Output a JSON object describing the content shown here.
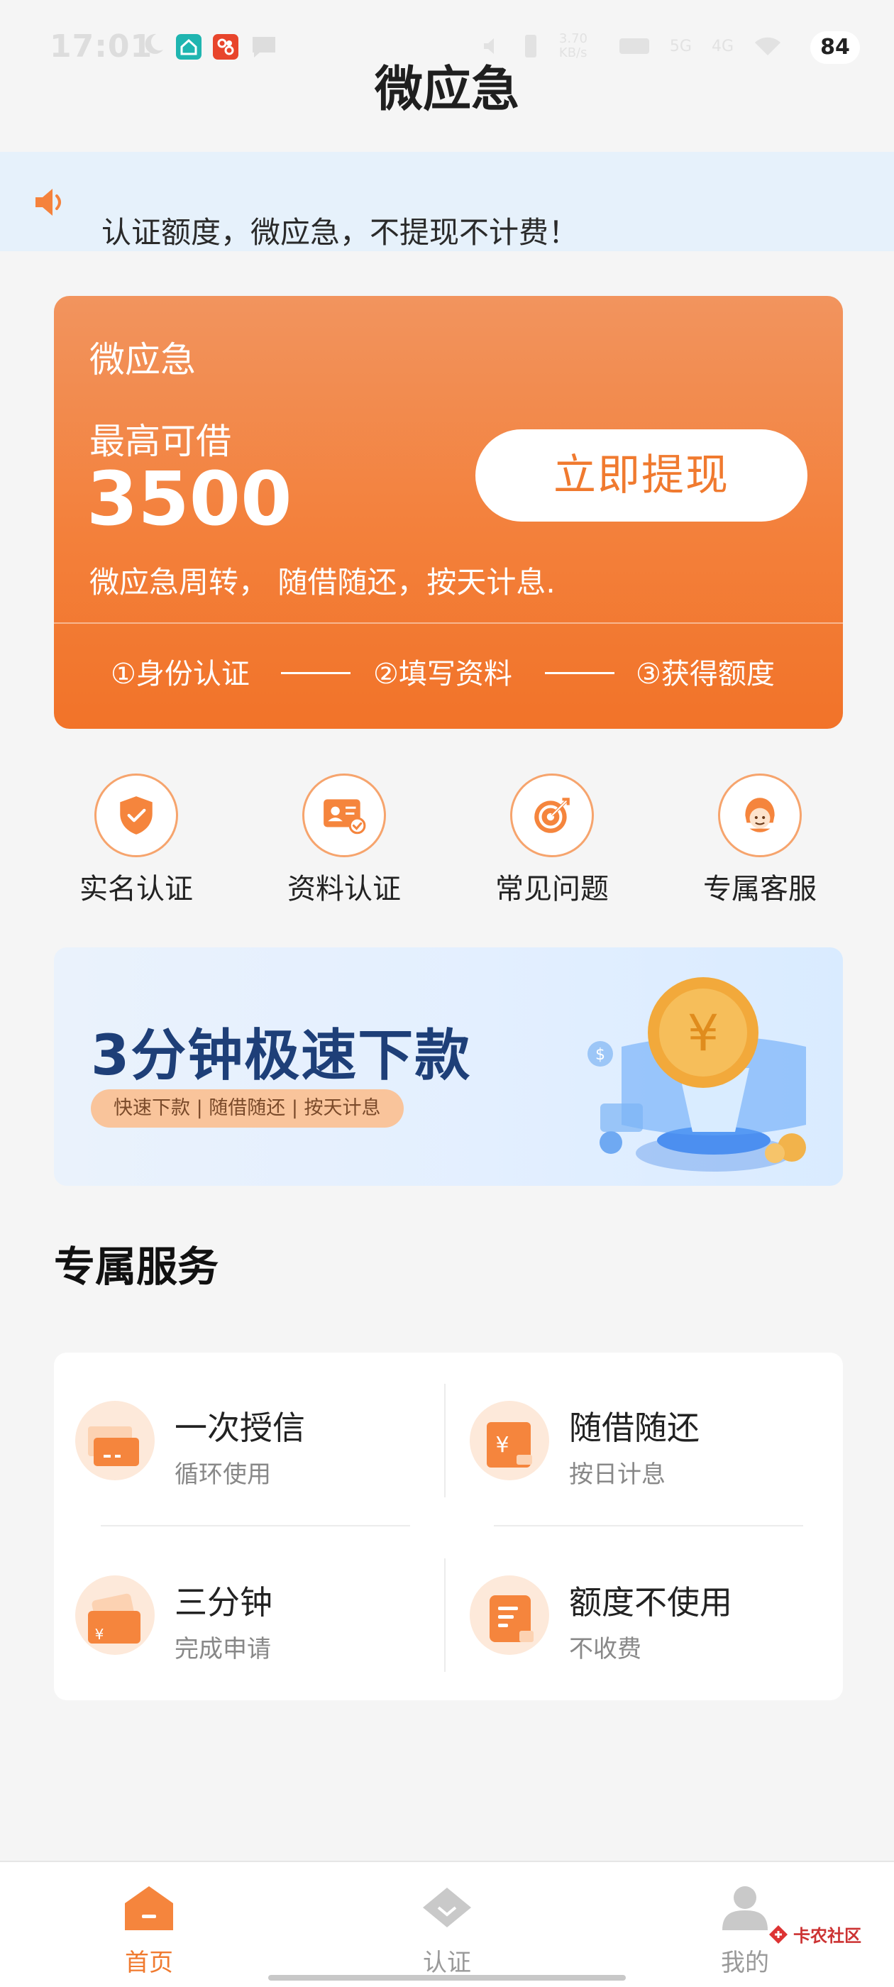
{
  "status_bar": {
    "time": "17:01",
    "net_speed": "3.70 KB/s",
    "signal_1": "5G",
    "signal_2": "4G",
    "battery": "84",
    "icons": [
      "moon-icon",
      "home-app-icon",
      "app-icon",
      "message-icon",
      "mute-icon",
      "vibrate-icon",
      "hd-icon",
      "wifi-icon"
    ]
  },
  "header": {
    "title": "微应急"
  },
  "notice": {
    "text": "认证额度，微应急，不提现不计费！",
    "icon": "speaker-icon"
  },
  "hero": {
    "brand": "微应急",
    "label": "最高可借",
    "amount": "3500",
    "button": "立即提现",
    "desc": "微应急周转， 随借随还，按天计息.",
    "steps": [
      "①身份认证",
      "②填写资料",
      "③获得额度"
    ]
  },
  "quick_actions": [
    {
      "label": "实名认证",
      "icon": "shield-check-icon"
    },
    {
      "label": "资料认证",
      "icon": "id-card-icon"
    },
    {
      "label": "常见问题",
      "icon": "target-icon"
    },
    {
      "label": "专属客服",
      "icon": "customer-service-icon"
    }
  ],
  "banner": {
    "title": "3分钟极速下款",
    "pill": "快速下款 | 随借随还 | 按天计息"
  },
  "services": {
    "title": "专属服务",
    "items": [
      {
        "title": "一次授信",
        "sub": "循环使用",
        "icon": "card-icon"
      },
      {
        "title": "随借随还",
        "sub": "按日计息",
        "icon": "yuan-note-icon"
      },
      {
        "title": "三分钟",
        "sub": "完成申请",
        "icon": "wallet-icon"
      },
      {
        "title": "额度不使用",
        "sub": "不收费",
        "icon": "document-icon"
      }
    ]
  },
  "tabbar": {
    "items": [
      {
        "label": "首页",
        "icon": "home-icon",
        "active": true
      },
      {
        "label": "认证",
        "icon": "diamond-icon",
        "active": false
      },
      {
        "label": "我的",
        "icon": "user-icon",
        "active": false
      }
    ]
  },
  "watermark": {
    "text": "卡农社区"
  },
  "colors": {
    "accent": "#f3803b",
    "tab_active": "#f07a2f",
    "tab_inactive": "#9a9a9a"
  }
}
